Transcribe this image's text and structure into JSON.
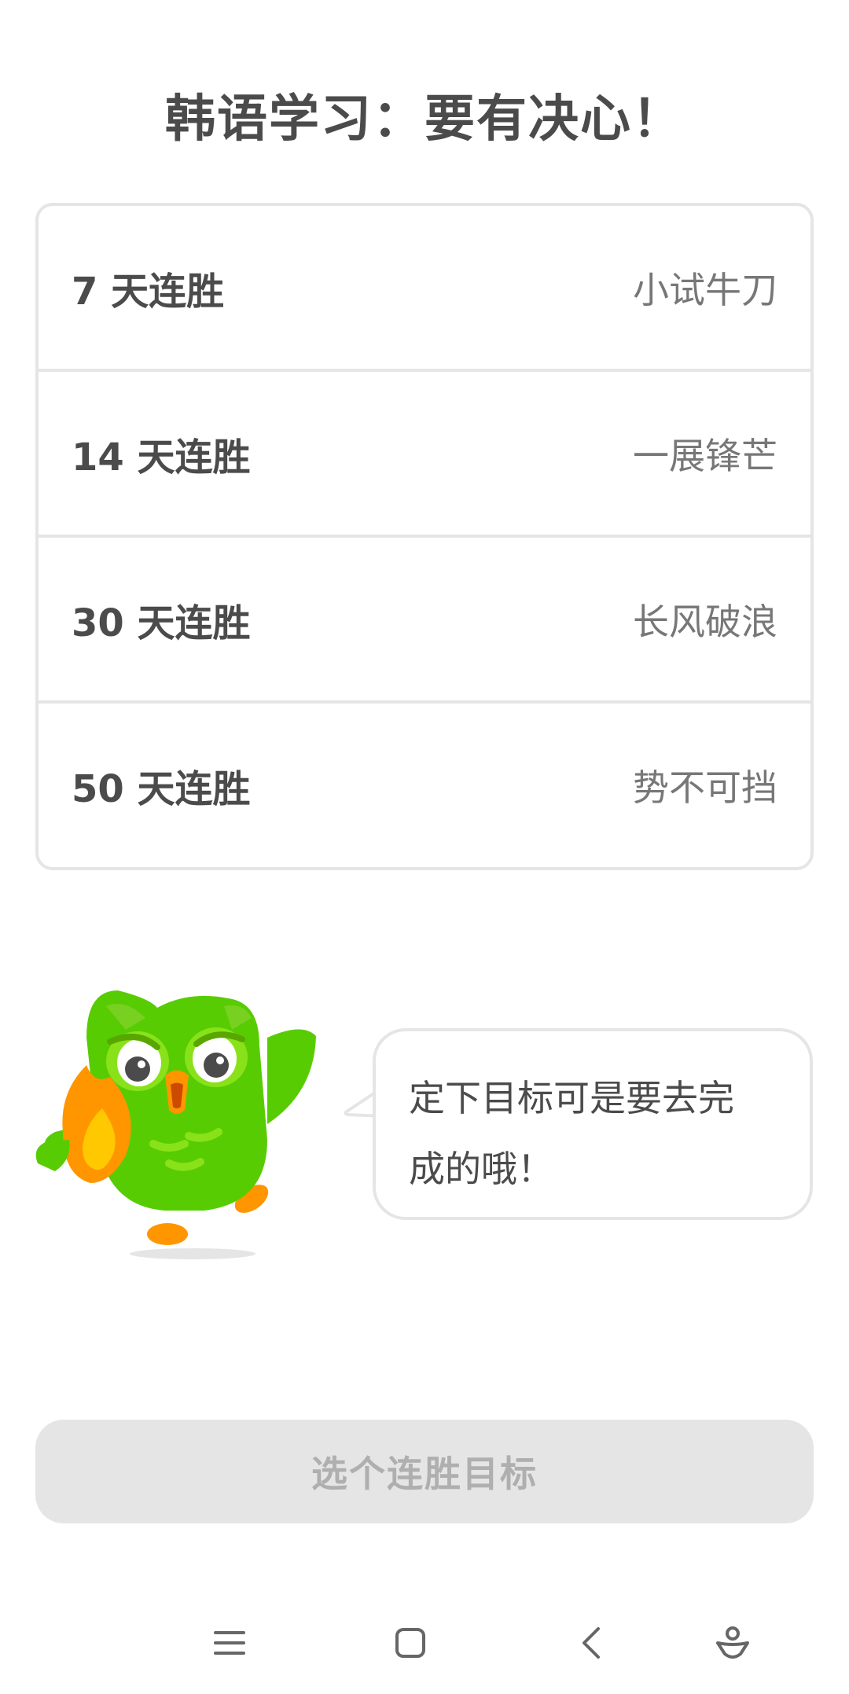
{
  "header": {
    "title": "韩语学习：要有决心！"
  },
  "goals": [
    {
      "days": "7 天连胜",
      "label": "小试牛刀"
    },
    {
      "days": "14 天连胜",
      "label": "一展锋芒"
    },
    {
      "days": "30 天连胜",
      "label": "长风破浪"
    },
    {
      "days": "50 天连胜",
      "label": "势不可挡"
    }
  ],
  "bubble": {
    "line1": "定下目标可是要去完",
    "line2": "成的哦！"
  },
  "cta": {
    "label": "选个连胜目标"
  },
  "icons": {
    "mascot": "duo-owl-with-flame-icon",
    "menu": "menu-icon",
    "home": "home-square-icon",
    "back": "back-chevron-icon",
    "assistant": "assistant-icon"
  },
  "colors": {
    "owl_green": "#58cc02",
    "flame_orange": "#ff9600",
    "border": "#e5e5e5",
    "disabled_button": "#e5e5e5",
    "disabled_text": "#afafaf"
  }
}
